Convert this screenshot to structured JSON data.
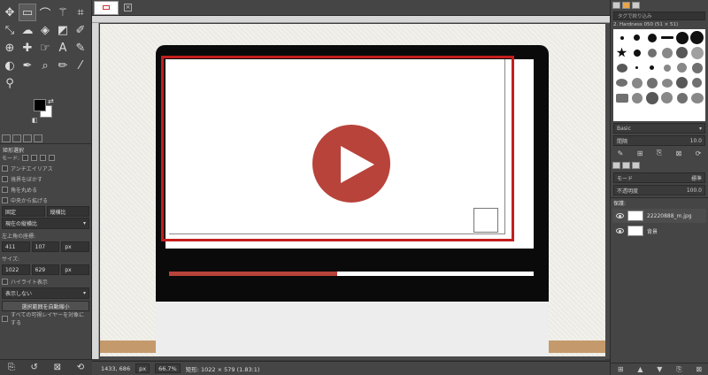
{
  "toolbox": {
    "tools": [
      "move-icon",
      "rect-select-icon",
      "lasso-icon",
      "fuzzy-select-icon",
      "crop-icon",
      "transform-icon",
      "warp-icon",
      "bucket-icon",
      "gradient-icon",
      "eraser-icon",
      "clone-icon",
      "heal-icon",
      "smudge-icon",
      "text-icon",
      "path-icon",
      "dodge-icon",
      "ink-icon",
      "airbrush-icon",
      "brush-icon",
      "pencil-icon",
      "zoom-icon"
    ],
    "options_title": "矩形選択",
    "mode_label": "モード:",
    "antialias": "アンチエイリアス",
    "feather": "境界をぼかす",
    "rounded": "角を丸める",
    "expand": "中央から拡げる",
    "fixed_label": "固定",
    "fixed_value": "縦横比",
    "current_label": "現在の縦横比",
    "pos_label": "左上角の座標:",
    "pos_x": "411",
    "pos_y": "107",
    "pos_unit": "px",
    "size_label": "サイズ:",
    "size_w": "1022",
    "size_h": "629",
    "size_unit": "px",
    "highlight": "ハイライト表示",
    "guides": "表示しない",
    "autoshrink": "選択範囲を自動縮小",
    "merged": "すべての可視レイヤーを対象にする"
  },
  "image_tab": {
    "close_label": "×"
  },
  "status": {
    "coords": "1433, 686",
    "unit": "px",
    "zoom": "66.7%",
    "info": "矩形: 1022 × 579  (1.83:1)"
  },
  "canvas": {
    "progress_fraction": 0.46
  },
  "dock": {
    "filter_placeholder": "タグで絞り込み",
    "brush_name": "2. Hardness 050 (51 × 51)",
    "brush_category": "Basic",
    "spacing_label": "間隔",
    "spacing_value": "10.0",
    "mode_label": "モード",
    "mode_value": "標準",
    "opacity_label": "不透明度",
    "opacity_value": "100.0",
    "lock_label": "保護:",
    "layers": [
      {
        "name": "22220888_m.jpg",
        "active": true
      },
      {
        "name": "背景",
        "active": false
      }
    ]
  }
}
